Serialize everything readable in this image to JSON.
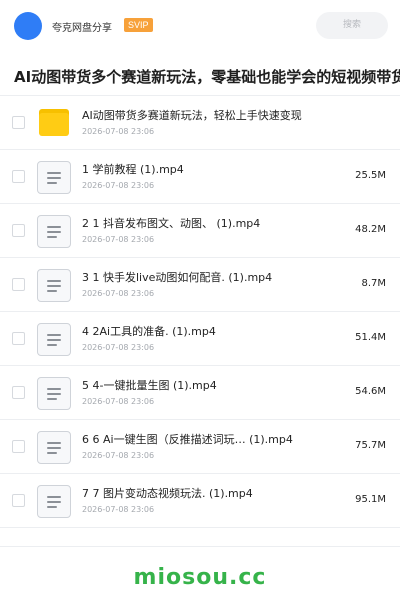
{
  "header": {
    "owner_name": "夸克网盘分享",
    "badge": "SVIP",
    "search_placeholder": "搜索"
  },
  "share_title": "AI动图带货多个赛道新玩法，零基础也能学会的短视频带货",
  "items": [
    {
      "type": "folder",
      "name": "AI动图带货多赛道新玩法，轻松上手快速变现",
      "date": "2026-07-08 23:06",
      "size": ""
    },
    {
      "type": "file",
      "name": "1 学前教程 (1).mp4",
      "date": "2026-07-08 23:06",
      "size": "25.5M"
    },
    {
      "type": "file",
      "name": "2 1 抖音发布图文、动图、 (1).mp4",
      "date": "2026-07-08 23:06",
      "size": "48.2M"
    },
    {
      "type": "file",
      "name": "3 1 快手发live动图如何配音. (1).mp4",
      "date": "2026-07-08 23:06",
      "size": "8.7M"
    },
    {
      "type": "file",
      "name": "4 2Ai工具的准备. (1).mp4",
      "date": "2026-07-08 23:06",
      "size": "51.4M"
    },
    {
      "type": "file",
      "name": "5 4-一键批量生图 (1).mp4",
      "date": "2026-07-08 23:06",
      "size": "54.6M"
    },
    {
      "type": "file",
      "name": "6 6 Ai一键生图（反推描述词玩… (1).mp4",
      "date": "2026-07-08 23:06",
      "size": "75.7M"
    },
    {
      "type": "file",
      "name": "7 7 图片变动态视频玩法. (1).mp4",
      "date": "2026-07-08 23:06",
      "size": "95.1M"
    }
  ],
  "watermark": "miosou.cc",
  "colors": {
    "accent": "#2f7df6",
    "badge": "#f7a13a",
    "folder": "#ffcc14",
    "watermark": "#36b34a"
  }
}
